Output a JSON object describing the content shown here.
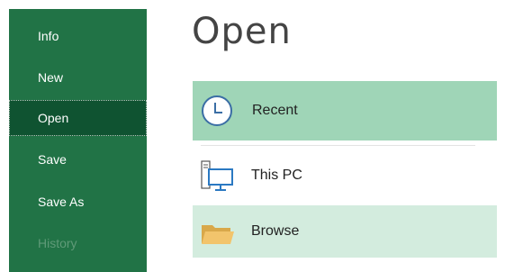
{
  "sidebar": {
    "items": [
      {
        "label": "Info"
      },
      {
        "label": "New"
      },
      {
        "label": "Open"
      },
      {
        "label": "Save"
      },
      {
        "label": "Save As"
      },
      {
        "label": "History"
      }
    ]
  },
  "main": {
    "title": "Open",
    "locations": [
      {
        "label": "Recent",
        "icon": "clock-icon"
      },
      {
        "label": "This PC",
        "icon": "computer-icon"
      },
      {
        "label": "Browse",
        "icon": "folder-icon"
      }
    ]
  },
  "colors": {
    "sidebar_bg": "#217346",
    "sidebar_active": "#0f5331",
    "recent_highlight": "#9fd5b7",
    "browse_highlight": "#d3ecde"
  }
}
